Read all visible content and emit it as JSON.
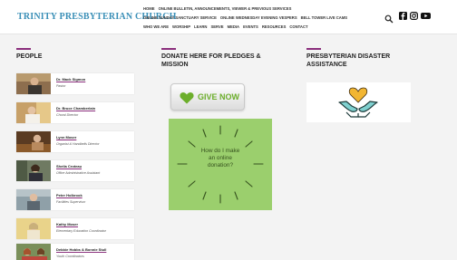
{
  "site": {
    "name": "TRINITY PRESBYTERIAN CHURCH"
  },
  "nav": {
    "row1": [
      "HOME",
      "ONLINE BULLETIN, ANNOUNCEMENTS, VIEWER & PREVIOUS SERVICES"
    ],
    "row2": [
      "ONLINE SUNDAY SANCTUARY SERVICE",
      "ONLINE WEDNESDAY EVENING VESPERS",
      "BELL TOWER LIVE CAMS"
    ],
    "row3": [
      "WHO WE ARE",
      "WORSHIP",
      "LEARN",
      "SERVE",
      "MEDIA",
      "EVENTS",
      "RESOURCES",
      "CONTACT"
    ]
  },
  "icons": {
    "search": "search-icon",
    "facebook": "facebook-icon",
    "instagram": "instagram-icon",
    "youtube": "youtube-icon"
  },
  "sections": {
    "people": "PEOPLE",
    "donate": "DONATE HERE FOR PLEDGES & MISSION",
    "disaster": "PRESBYTERIAN DISASTER ASSISTANCE"
  },
  "people": [
    {
      "name": "Dr. Mack Sigmon",
      "role": "Pastor"
    },
    {
      "name": "Dr. Bruce Chamberlain",
      "role": "Choral Director"
    },
    {
      "name": "Lynn Moser",
      "role": "Organist & Handbells Director"
    },
    {
      "name": "Sheila Croteau",
      "role": "Office Administrative Assistant"
    },
    {
      "name": "Peter Holbrook",
      "role": "Facilities Supervisor"
    },
    {
      "name": "Kathy Moser",
      "role": "Elementary Education Coordinator"
    },
    {
      "name": "Debbie Hobbs & Bonnie Stull",
      "role": "Youth Coordinators"
    }
  ],
  "give": {
    "label": "GIVE NOW"
  },
  "donation_question": "How do I make an online donation?",
  "colors": {
    "brand": "#3a8fb7",
    "accent": "#8a2e7c",
    "give_green": "#6cae2b",
    "donate_box": "#9bcf6d"
  }
}
